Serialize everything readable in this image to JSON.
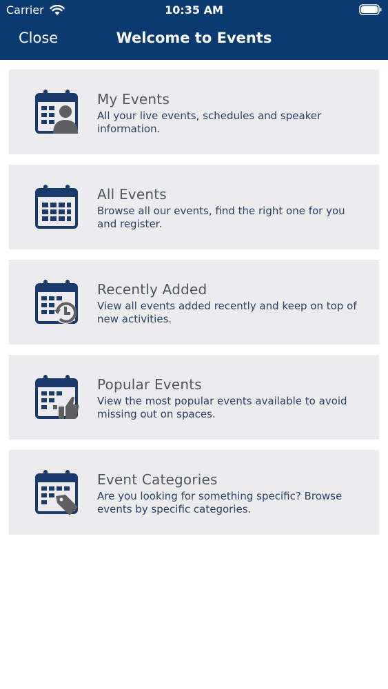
{
  "status_bar": {
    "carrier": "Carrier",
    "time": "10:35 AM"
  },
  "nav": {
    "close_label": "Close",
    "title": "Welcome to Events"
  },
  "colors": {
    "header": "#0b3a70",
    "card": "#ececee",
    "icon_navy": "#1a3a6b",
    "icon_gray": "#5d5f63"
  },
  "menu": {
    "items": [
      {
        "title": "My Events",
        "description": "All your live events, schedules and speaker information.",
        "icon": "calendar-person-icon"
      },
      {
        "title": "All Events",
        "description": "Browse all our events, find the right one for you and register.",
        "icon": "calendar-icon"
      },
      {
        "title": "Recently Added",
        "description": "View all events added recently and keep on top of new activities.",
        "icon": "calendar-clock-icon"
      },
      {
        "title": "Popular Events",
        "description": "View the most popular events available to avoid missing out on spaces.",
        "icon": "calendar-thumbs-up-icon"
      },
      {
        "title": "Event Categories",
        "description": "Are you looking for something specific? Browse events by specific categories.",
        "icon": "calendar-tag-icon"
      }
    ]
  }
}
